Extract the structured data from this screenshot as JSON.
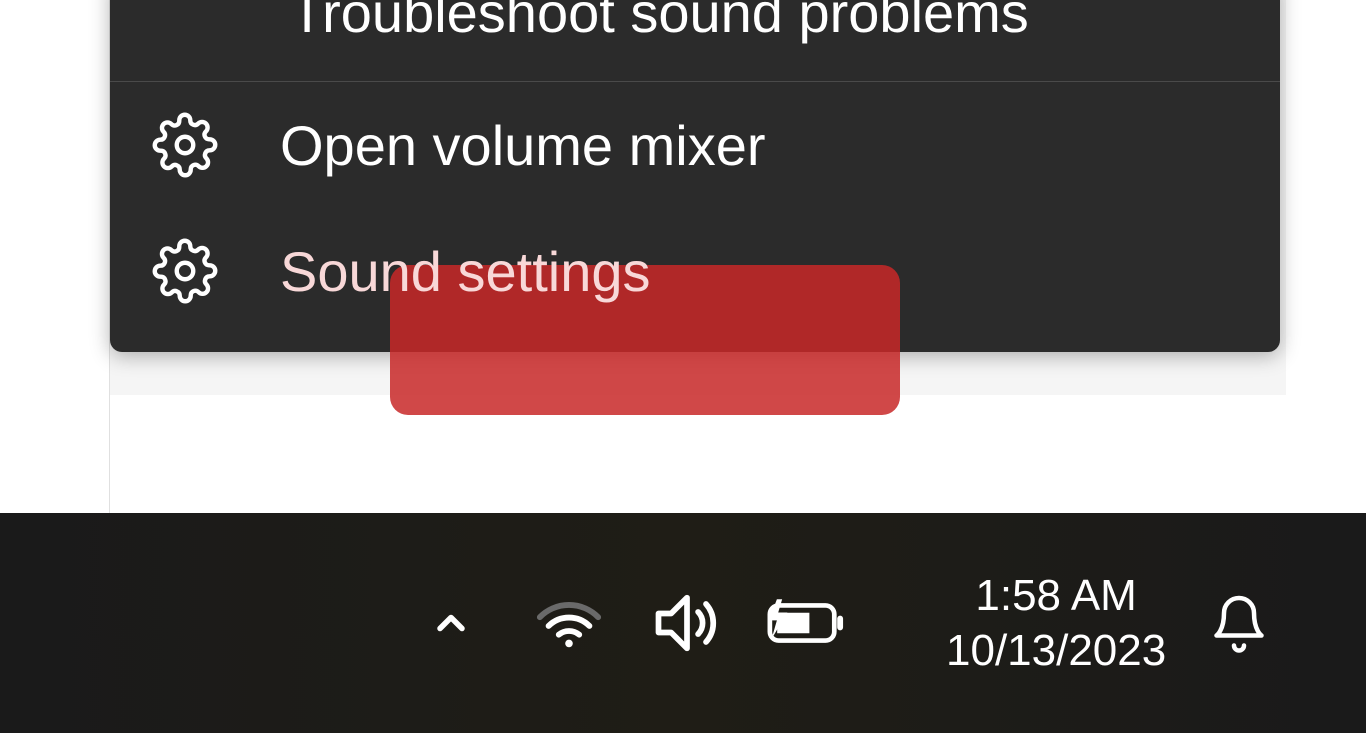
{
  "context_menu": {
    "items": [
      {
        "label": "Troubleshoot sound problems",
        "has_icon": false
      },
      {
        "label": "Open volume mixer",
        "has_icon": true
      },
      {
        "label": "Sound settings",
        "has_icon": true,
        "highlighted": true
      }
    ]
  },
  "taskbar": {
    "time": "1:58 AM",
    "date": "10/13/2023"
  },
  "highlight_color": "#c82828"
}
